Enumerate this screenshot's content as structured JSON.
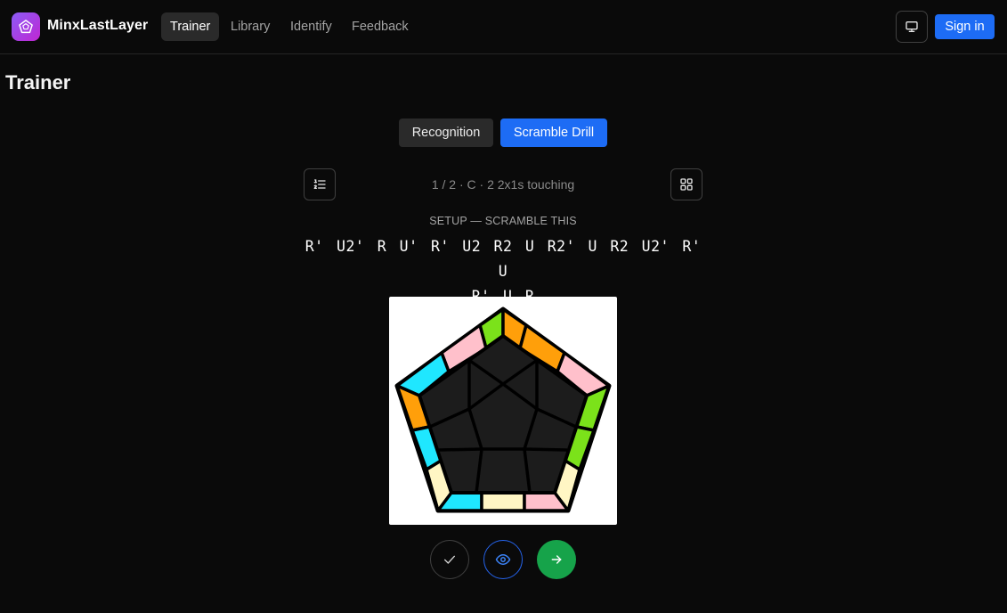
{
  "header": {
    "app_name": "MinxLastLayer",
    "nav": [
      {
        "label": "Trainer",
        "active": true
      },
      {
        "label": "Library",
        "active": false
      },
      {
        "label": "Identify",
        "active": false
      },
      {
        "label": "Feedback",
        "active": false
      }
    ],
    "display_icon": "monitor-icon",
    "signin_label": "Sign in",
    "accent_color": "#1d6cf5"
  },
  "page": {
    "title": "Trainer"
  },
  "modes": {
    "recognition_label": "Recognition",
    "scramble_label": "Scramble Drill",
    "active": "Scramble Drill"
  },
  "drill": {
    "case_info": "1 / 2 · C · 2 2x1s touching",
    "list_icon": "list-ordered-icon",
    "grid_icon": "grid-icon",
    "setup_label": "SETUP — SCRAMBLE THIS",
    "algorithm_line1": "R' U2' R U' R' U2 R2 U R2' U R2 U2' R' U",
    "algorithm_line2": "R' U R"
  },
  "puzzle": {
    "face_color": "#1c1c1c",
    "sticker_colors": {
      "green": "#7be21a",
      "orange": "#ff9f0a",
      "pink": "#ffc0cb",
      "cyan": "#1fe7ff",
      "cream": "#fff6c4"
    }
  },
  "actions": {
    "check_icon": "check-icon",
    "reveal_icon": "eye-icon",
    "next_icon": "arrow-right-icon",
    "next_color": "#16a34a"
  }
}
